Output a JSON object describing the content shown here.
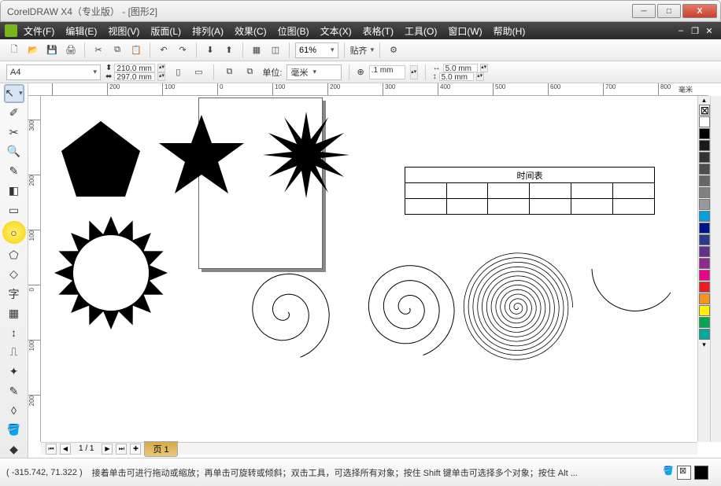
{
  "title": "CorelDRAW X4（专业版） - [图形2]",
  "menus": [
    "文件(F)",
    "编辑(E)",
    "视图(V)",
    "版面(L)",
    "排列(A)",
    "效果(C)",
    "位图(B)",
    "文本(X)",
    "表格(T)",
    "工具(O)",
    "窗口(W)",
    "帮助(H)"
  ],
  "toolbar": {
    "zoom": "61%",
    "snap_label": "贴齐"
  },
  "propbar": {
    "paper": "A4",
    "width": "210.0 mm",
    "height": "297.0 mm",
    "unit_label": "单位:",
    "unit_value": "毫米",
    "nudge": ".1 mm",
    "dup_x": "5.0 mm",
    "dup_y": "5.0 mm"
  },
  "ruler_h_ticks": [
    {
      "v": "",
      "p": 30
    },
    {
      "v": "200",
      "p": 100
    },
    {
      "v": "100",
      "p": 170
    },
    {
      "v": "0",
      "p": 240
    },
    {
      "v": "100",
      "p": 310
    },
    {
      "v": "200",
      "p": 380
    },
    {
      "v": "300",
      "p": 450
    },
    {
      "v": "400",
      "p": 520
    },
    {
      "v": "500",
      "p": 590
    },
    {
      "v": "600",
      "p": 660
    },
    {
      "v": "700",
      "p": 730
    },
    {
      "v": "800",
      "p": 800
    }
  ],
  "ruler_h_unit": "毫米",
  "ruler_v_ticks": [
    {
      "v": "300",
      "p": 30
    },
    {
      "v": "200",
      "p": 100
    },
    {
      "v": "100",
      "p": 170
    },
    {
      "v": "0",
      "p": 240
    },
    {
      "v": "100",
      "p": 310
    },
    {
      "v": "200",
      "p": 380
    }
  ],
  "page_nav": {
    "pages": "1 / 1",
    "tab": "页 1"
  },
  "status": {
    "coord": "( -315.742, 71.322 )",
    "hint": "接着单击可进行拖动或缩放；再单击可旋转或倾斜；双击工具，可选择所有对象；按住 Shift 键单击可选择多个对象；按住 Alt ..."
  },
  "table_caption": "时间表",
  "palette": [
    "#ffffff",
    "#000000",
    "#1a1a1a",
    "#333333",
    "#4d4d4d",
    "#666666",
    "#808080",
    "#999999",
    "#00a0e3",
    "#001288",
    "#2b3990",
    "#662d91",
    "#92278f",
    "#ec008c",
    "#ed1c24",
    "#f7941d",
    "#fff200",
    "#00a651",
    "#00a99d"
  ],
  "tools": [
    "pick",
    "shape",
    "crop",
    "zoom",
    "freehand",
    "smart",
    "rectangle",
    "ellipse",
    "polygon",
    "basic",
    "text",
    "table",
    "dimension",
    "connector",
    "interactive",
    "eyedrop",
    "outline",
    "fill",
    "ifill"
  ]
}
